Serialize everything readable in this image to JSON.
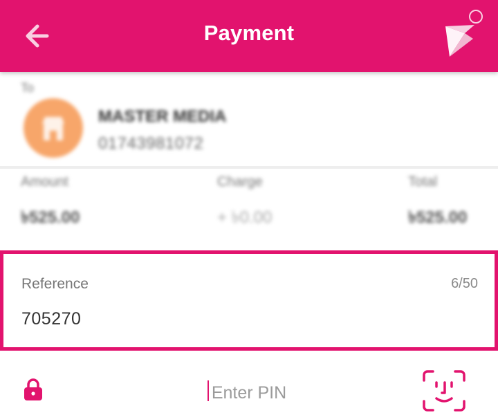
{
  "header": {
    "title": "Payment",
    "back_icon": "arrow-left-icon",
    "logo_icon": "bird-logo-icon",
    "background_color": "#e2136e"
  },
  "recipient": {
    "label": "To",
    "name": "MASTER MEDIA",
    "number": "01743981072",
    "avatar_icon": "merchant-store-icon",
    "avatar_color": "#f7a66a"
  },
  "summary": {
    "amount_label": "Amount",
    "amount_value": "৳525.00",
    "charge_label": "Charge",
    "charge_value": "+ ৳0.00",
    "total_label": "Total",
    "total_value": "৳525.00"
  },
  "reference": {
    "label": "Reference",
    "value": "705270",
    "counter": "6/50",
    "border_color": "#e2136e"
  },
  "pin": {
    "placeholder": "Enter PIN",
    "lock_icon": "lock-icon",
    "face_icon": "face-id-icon"
  }
}
